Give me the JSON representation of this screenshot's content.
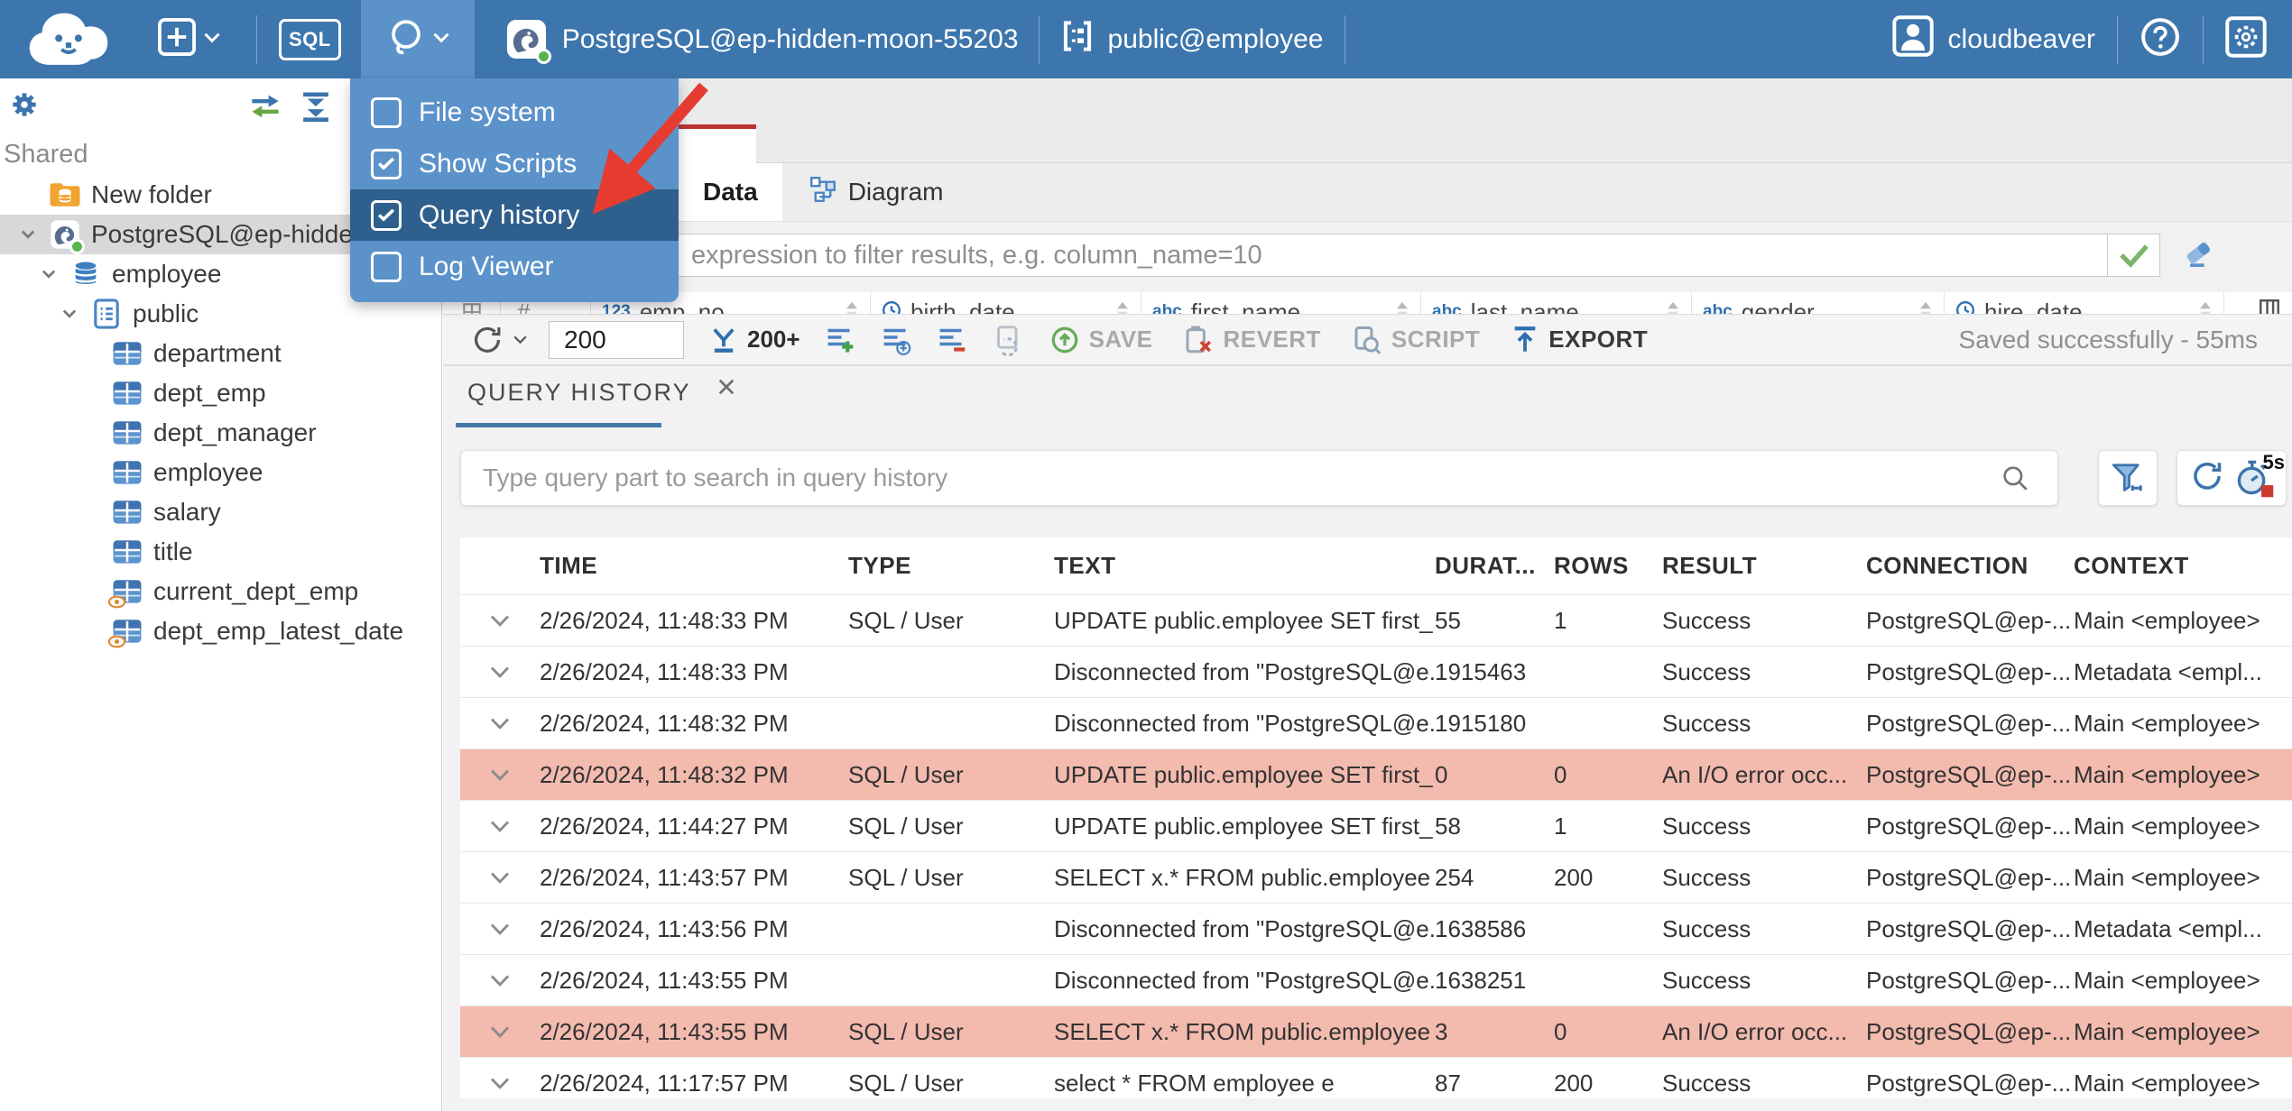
{
  "colors": {
    "topbar": "#3d76ad",
    "menu": "#5b92c9",
    "menu_highlight": "#2f5f8c",
    "tab_red": "#c0322f",
    "underline_blue": "#4779a8",
    "error_row": "#f3baae",
    "arrow_red": "#e53b30",
    "accent_blue": "#2f6fb0"
  },
  "topbar": {
    "sql_label": "SQL",
    "connection_label": "PostgreSQL@ep-hidden-moon-55203",
    "schema_label": "public@employee",
    "user_label": "cloudbeaver"
  },
  "tools_menu": {
    "items": [
      {
        "label": "File system",
        "checked": false,
        "highlighted": false
      },
      {
        "label": "Show Scripts",
        "checked": true,
        "highlighted": false
      },
      {
        "label": "Query history",
        "checked": true,
        "highlighted": true
      },
      {
        "label": "Log Viewer",
        "checked": false,
        "highlighted": false
      }
    ]
  },
  "sidebar": {
    "section_label": "Shared",
    "tree": [
      {
        "label": "New folder",
        "icon": "folder",
        "depth": 0,
        "chevron": false,
        "selected": false
      },
      {
        "label": "PostgreSQL@ep-hidden-",
        "icon": "postgres",
        "depth": 0,
        "chevron": true,
        "selected": true
      },
      {
        "label": "employee",
        "icon": "database",
        "depth": 1,
        "chevron": true,
        "selected": false
      },
      {
        "label": "public",
        "icon": "schema",
        "depth": 2,
        "chevron": true,
        "selected": false
      },
      {
        "label": "department",
        "icon": "table",
        "depth": 3,
        "chevron": false,
        "selected": false
      },
      {
        "label": "dept_emp",
        "icon": "table",
        "depth": 3,
        "chevron": false,
        "selected": false
      },
      {
        "label": "dept_manager",
        "icon": "table",
        "depth": 3,
        "chevron": false,
        "selected": false
      },
      {
        "label": "employee",
        "icon": "table",
        "depth": 3,
        "chevron": false,
        "selected": false
      },
      {
        "label": "salary",
        "icon": "table",
        "depth": 3,
        "chevron": false,
        "selected": false
      },
      {
        "label": "title",
        "icon": "table",
        "depth": 3,
        "chevron": false,
        "selected": false
      },
      {
        "label": "current_dept_emp",
        "icon": "view",
        "depth": 3,
        "chevron": false,
        "selected": false
      },
      {
        "label": "dept_emp_latest_date",
        "icon": "view",
        "depth": 3,
        "chevron": false,
        "selected": false
      }
    ]
  },
  "editor": {
    "data_tab": "Data",
    "diagram_tab": "Diagram",
    "filter_placeholder": "expression to filter results, e.g. column_name=10",
    "row_number_header": "#",
    "grid_columns": [
      {
        "prefix": "123",
        "name": "emp_no"
      },
      {
        "prefix": "clock",
        "name": "birth_date"
      },
      {
        "prefix": "abc",
        "name": "first_name"
      },
      {
        "prefix": "abc",
        "name": "last_name"
      },
      {
        "prefix": "abc",
        "name": "gender"
      },
      {
        "prefix": "clock",
        "name": "hire_date"
      }
    ],
    "toolbar": {
      "fetch_size": "200",
      "fetch_more_label": "200+",
      "save_label": "SAVE",
      "revert_label": "REVERT",
      "script_label": "SCRIPT",
      "export_label": "EXPORT",
      "status": "Saved successfully - 55ms"
    }
  },
  "history": {
    "tab_label": "QUERY HISTORY",
    "search_placeholder": "Type query part to search in query history",
    "refresh_interval_label": "5s",
    "columns": [
      "TIME",
      "TYPE",
      "TEXT",
      "DURAT...",
      "ROWS",
      "RESULT",
      "CONNECTION",
      "CONTEXT"
    ],
    "rows": [
      {
        "time": "2/26/2024, 11:48:33 PM",
        "type": "SQL / User",
        "text": "UPDATE public.employee SET first_...",
        "duration": "55",
        "rows": "1",
        "result": "Success",
        "connection": "PostgreSQL@ep-...",
        "context": "Main <employee>",
        "error": false
      },
      {
        "time": "2/26/2024, 11:48:33 PM",
        "type": "",
        "text": "Disconnected from \"PostgreSQL@e...",
        "duration": "1915463",
        "rows": "",
        "result": "Success",
        "connection": "PostgreSQL@ep-...",
        "context": "Metadata <empl...",
        "error": false
      },
      {
        "time": "2/26/2024, 11:48:32 PM",
        "type": "",
        "text": "Disconnected from \"PostgreSQL@e...",
        "duration": "1915180",
        "rows": "",
        "result": "Success",
        "connection": "PostgreSQL@ep-...",
        "context": "Main <employee>",
        "error": false
      },
      {
        "time": "2/26/2024, 11:48:32 PM",
        "type": "SQL / User",
        "text": "UPDATE public.employee SET first_...",
        "duration": "0",
        "rows": "0",
        "result": "An I/O error occ...",
        "connection": "PostgreSQL@ep-...",
        "context": "Main <employee>",
        "error": true
      },
      {
        "time": "2/26/2024, 11:44:27 PM",
        "type": "SQL / User",
        "text": "UPDATE public.employee SET first_...",
        "duration": "58",
        "rows": "1",
        "result": "Success",
        "connection": "PostgreSQL@ep-...",
        "context": "Main <employee>",
        "error": false
      },
      {
        "time": "2/26/2024, 11:43:57 PM",
        "type": "SQL / User",
        "text": "SELECT x.* FROM public.employee x",
        "duration": "254",
        "rows": "200",
        "result": "Success",
        "connection": "PostgreSQL@ep-...",
        "context": "Main <employee>",
        "error": false
      },
      {
        "time": "2/26/2024, 11:43:56 PM",
        "type": "",
        "text": "Disconnected from \"PostgreSQL@e...",
        "duration": "1638586",
        "rows": "",
        "result": "Success",
        "connection": "PostgreSQL@ep-...",
        "context": "Metadata <empl...",
        "error": false
      },
      {
        "time": "2/26/2024, 11:43:55 PM",
        "type": "",
        "text": "Disconnected from \"PostgreSQL@e...",
        "duration": "1638251",
        "rows": "",
        "result": "Success",
        "connection": "PostgreSQL@ep-...",
        "context": "Main <employee>",
        "error": false
      },
      {
        "time": "2/26/2024, 11:43:55 PM",
        "type": "SQL / User",
        "text": "SELECT x.* FROM public.employee x",
        "duration": "3",
        "rows": "0",
        "result": "An I/O error occ...",
        "connection": "PostgreSQL@ep-...",
        "context": "Main <employee>",
        "error": true
      },
      {
        "time": "2/26/2024, 11:17:57 PM",
        "type": "SQL / User",
        "text": "select * FROM employee e",
        "duration": "87",
        "rows": "200",
        "result": "Success",
        "connection": "PostgreSQL@ep-...",
        "context": "Main <employee>",
        "error": false
      }
    ]
  }
}
